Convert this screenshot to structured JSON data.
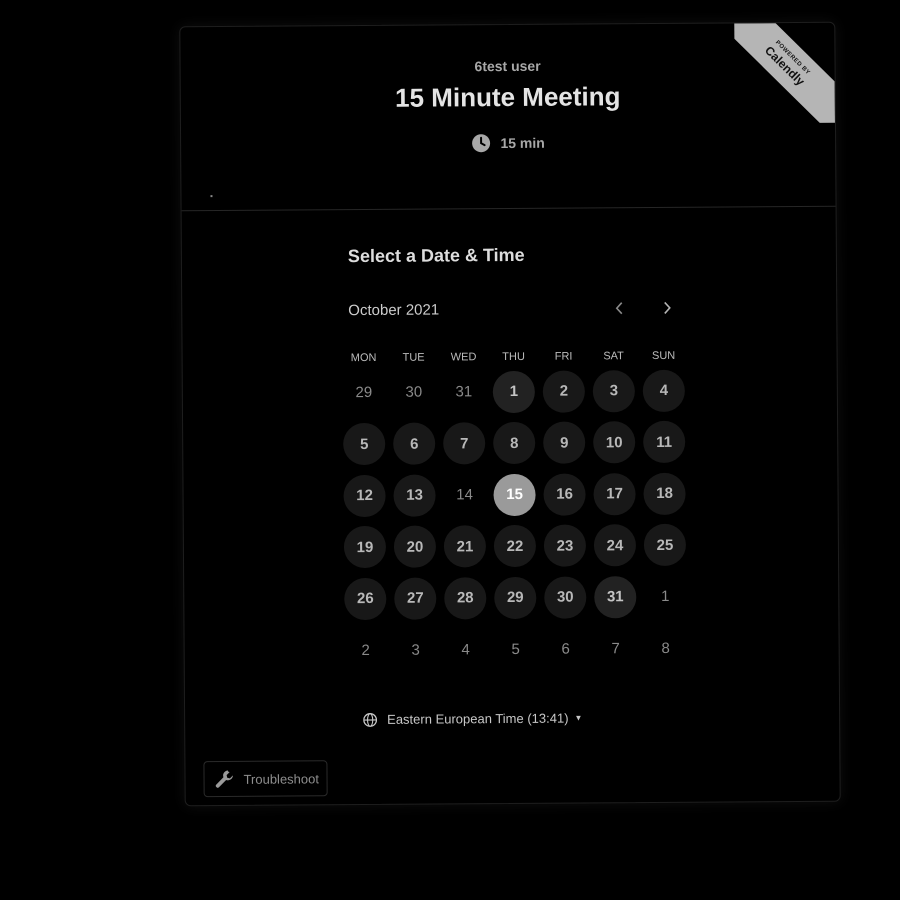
{
  "badge": {
    "top_text": "POWERED BY",
    "brand": "Calendly"
  },
  "header": {
    "owner": "6test user",
    "title": "15 Minute Meeting",
    "duration": "15 min",
    "duration_icon": "clock-icon"
  },
  "scheduler": {
    "section_title": "Select a Date & Time",
    "month": "October 2021",
    "prev_icon": "chevron-left-icon",
    "next_icon": "chevron-right-icon",
    "weekdays": [
      "MON",
      "TUE",
      "WED",
      "THU",
      "FRI",
      "SAT",
      "SUN"
    ],
    "days": [
      {
        "label": "29",
        "state": "outside"
      },
      {
        "label": "30",
        "state": "outside"
      },
      {
        "label": "31",
        "state": "outside"
      },
      {
        "label": "1",
        "state": "available-strong"
      },
      {
        "label": "2",
        "state": "available"
      },
      {
        "label": "3",
        "state": "available"
      },
      {
        "label": "4",
        "state": "available"
      },
      {
        "label": "5",
        "state": "available"
      },
      {
        "label": "6",
        "state": "available"
      },
      {
        "label": "7",
        "state": "available"
      },
      {
        "label": "8",
        "state": "available"
      },
      {
        "label": "9",
        "state": "available"
      },
      {
        "label": "10",
        "state": "available"
      },
      {
        "label": "11",
        "state": "available"
      },
      {
        "label": "12",
        "state": "available"
      },
      {
        "label": "13",
        "state": "available"
      },
      {
        "label": "14",
        "state": "unavailable"
      },
      {
        "label": "15",
        "state": "selected"
      },
      {
        "label": "16",
        "state": "available"
      },
      {
        "label": "17",
        "state": "available"
      },
      {
        "label": "18",
        "state": "available"
      },
      {
        "label": "19",
        "state": "available"
      },
      {
        "label": "20",
        "state": "available"
      },
      {
        "label": "21",
        "state": "available"
      },
      {
        "label": "22",
        "state": "available"
      },
      {
        "label": "23",
        "state": "available"
      },
      {
        "label": "24",
        "state": "available"
      },
      {
        "label": "25",
        "state": "available"
      },
      {
        "label": "26",
        "state": "available"
      },
      {
        "label": "27",
        "state": "available"
      },
      {
        "label": "28",
        "state": "available"
      },
      {
        "label": "29",
        "state": "available"
      },
      {
        "label": "30",
        "state": "available"
      },
      {
        "label": "31",
        "state": "available-strong"
      },
      {
        "label": "1",
        "state": "outside"
      },
      {
        "label": "2",
        "state": "outside"
      },
      {
        "label": "3",
        "state": "outside"
      },
      {
        "label": "4",
        "state": "outside"
      },
      {
        "label": "5",
        "state": "outside"
      },
      {
        "label": "6",
        "state": "outside"
      },
      {
        "label": "7",
        "state": "outside"
      },
      {
        "label": "8",
        "state": "outside"
      }
    ],
    "timezone": "Eastern European Time (13:41)",
    "timezone_icon": "globe-icon"
  },
  "footer": {
    "troubleshoot_label": "Troubleshoot",
    "troubleshoot_icon": "wrench-icon"
  }
}
